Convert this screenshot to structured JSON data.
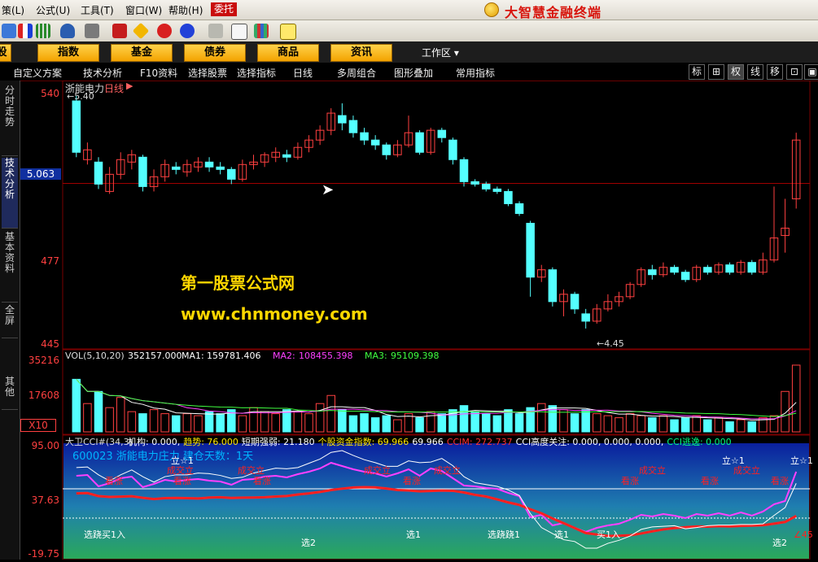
{
  "menubar": {
    "items": [
      {
        "label": "策(L)"
      },
      {
        "label": "公式(U)"
      },
      {
        "label": "工具(T)"
      },
      {
        "label": "窗口(W)"
      },
      {
        "label": "帮助(H)"
      }
    ],
    "order_button": "委托",
    "brand": "大智慧金融终端"
  },
  "category_bar": {
    "items": [
      "股",
      "指数",
      "基金",
      "债券",
      "商品",
      "资讯"
    ],
    "workspace_label": "工作区"
  },
  "sub_toolbar": {
    "items": [
      "自定义方案",
      "技术分析",
      "F10资料",
      "选择股票",
      "选择指标",
      "日线",
      "多周组合",
      "图形叠加",
      "常用指标"
    ],
    "right_buttons": [
      "标",
      "⊞",
      "权",
      "线",
      "移",
      "⊡",
      "▣"
    ]
  },
  "left_tabs": [
    "分时走势",
    "技术分析",
    "基本资料",
    "全屏",
    "其他"
  ],
  "price_chart": {
    "stock_name": "浙能电力",
    "period": "日线",
    "high_note": "5.40",
    "low_note": "4.45",
    "y_ticks": [
      "540",
      "5.063",
      "477",
      "445"
    ],
    "ylim": [
      4.4,
      5.45
    ],
    "current_price": 5.063,
    "candles": [
      [
        5.4,
        5.19,
        5.17,
        5.42
      ],
      [
        5.16,
        5.2,
        5.14,
        5.23
      ],
      [
        5.15,
        5.06,
        5.04,
        5.17
      ],
      [
        5.03,
        5.1,
        5.02,
        5.13
      ],
      [
        5.1,
        5.16,
        5.08,
        5.19
      ],
      [
        5.15,
        5.18,
        5.12,
        5.2
      ],
      [
        5.17,
        5.05,
        5.03,
        5.18
      ],
      [
        5.05,
        5.09,
        5.03,
        5.12
      ],
      [
        5.09,
        5.14,
        5.07,
        5.16
      ],
      [
        5.13,
        5.12,
        5.1,
        5.15
      ],
      [
        5.11,
        5.14,
        5.09,
        5.16
      ],
      [
        5.13,
        5.15,
        5.11,
        5.17
      ],
      [
        5.15,
        5.13,
        5.11,
        5.17
      ],
      [
        5.13,
        5.12,
        5.1,
        5.15
      ],
      [
        5.12,
        5.08,
        5.06,
        5.13
      ],
      [
        5.08,
        5.14,
        5.07,
        5.16
      ],
      [
        5.14,
        5.15,
        5.12,
        5.18
      ],
      [
        5.15,
        5.18,
        5.13,
        5.19
      ],
      [
        5.17,
        5.19,
        5.15,
        5.21
      ],
      [
        5.18,
        5.17,
        5.15,
        5.2
      ],
      [
        5.17,
        5.21,
        5.16,
        5.23
      ],
      [
        5.21,
        5.24,
        5.19,
        5.26
      ],
      [
        5.24,
        5.28,
        5.22,
        5.3
      ],
      [
        5.28,
        5.35,
        5.26,
        5.37
      ],
      [
        5.34,
        5.31,
        5.28,
        5.39
      ],
      [
        5.32,
        5.27,
        5.25,
        5.34
      ],
      [
        5.27,
        5.24,
        5.22,
        5.29
      ],
      [
        5.24,
        5.22,
        5.2,
        5.26
      ],
      [
        5.22,
        5.18,
        5.16,
        5.23
      ],
      [
        5.18,
        5.22,
        5.17,
        5.24
      ],
      [
        5.22,
        5.27,
        5.21,
        5.34
      ],
      [
        5.27,
        5.19,
        5.18,
        5.28
      ],
      [
        5.19,
        5.28,
        5.18,
        5.29
      ],
      [
        5.28,
        5.25,
        5.23,
        5.29
      ],
      [
        5.24,
        5.16,
        5.14,
        5.25
      ],
      [
        5.16,
        5.07,
        5.05,
        5.17
      ],
      [
        5.07,
        5.06,
        5.05,
        5.08
      ],
      [
        5.06,
        5.04,
        5.03,
        5.07
      ],
      [
        5.04,
        5.03,
        5.02,
        5.05
      ],
      [
        5.03,
        4.98,
        4.97,
        5.04
      ],
      [
        4.98,
        4.94,
        4.93,
        4.99
      ],
      [
        4.9,
        4.68,
        4.6,
        4.91
      ],
      [
        4.68,
        4.71,
        4.66,
        4.73
      ],
      [
        4.71,
        4.58,
        4.56,
        4.72
      ],
      [
        4.58,
        4.61,
        4.52,
        4.63
      ],
      [
        4.61,
        4.55,
        4.53,
        4.62
      ],
      [
        4.53,
        4.5,
        4.47,
        4.55
      ],
      [
        4.5,
        4.55,
        4.49,
        4.57
      ],
      [
        4.55,
        4.58,
        4.54,
        4.61
      ],
      [
        4.58,
        4.6,
        4.56,
        4.62
      ],
      [
        4.6,
        4.65,
        4.59,
        4.66
      ],
      [
        4.65,
        4.71,
        4.64,
        4.72
      ],
      [
        4.71,
        4.69,
        4.67,
        4.73
      ],
      [
        4.69,
        4.72,
        4.68,
        4.74
      ],
      [
        4.72,
        4.7,
        4.69,
        4.73
      ],
      [
        4.7,
        4.67,
        4.66,
        4.71
      ],
      [
        4.67,
        4.72,
        4.66,
        4.73
      ],
      [
        4.72,
        4.7,
        4.69,
        4.73
      ],
      [
        4.7,
        4.73,
        4.69,
        4.74
      ],
      [
        4.73,
        4.7,
        4.69,
        4.74
      ],
      [
        4.7,
        4.74,
        4.69,
        4.75
      ],
      [
        4.74,
        4.7,
        4.69,
        4.75
      ],
      [
        4.7,
        4.75,
        4.69,
        4.78
      ],
      [
        4.75,
        4.84,
        4.74,
        5.05
      ],
      [
        4.85,
        4.88,
        4.78,
        5.0
      ],
      [
        5.0,
        5.24,
        4.96,
        5.27
      ]
    ]
  },
  "volume_chart": {
    "header": "VOL(5,10,20)",
    "vol_value": "352157.000",
    "ma1_label": "MA1:",
    "ma1_value": "159781.406",
    "ma2_label": "MA2:",
    "ma2_value": "108455.398",
    "ma3_label": "MA3:",
    "ma3_value": "95109.398",
    "y_ticks": [
      "35216",
      "17608"
    ],
    "unit": "X10",
    "ylim": [
      0,
      37000
    ],
    "values": [
      26000,
      14000,
      20000,
      12000,
      17000,
      10000,
      9000,
      11000,
      9000,
      8000,
      9000,
      8000,
      10000,
      9000,
      11000,
      8000,
      12000,
      10000,
      9000,
      11000,
      10000,
      9000,
      14000,
      18000,
      11000,
      8000,
      9000,
      7000,
      8000,
      6000,
      9000,
      7000,
      10000,
      9000,
      11000,
      13000,
      10000,
      9000,
      8000,
      11000,
      9000,
      12000,
      14000,
      13000,
      11000,
      9000,
      11000,
      9000,
      8000,
      7000,
      9000,
      8000,
      7000,
      8000,
      6000,
      7000,
      8000,
      6000,
      7000,
      5000,
      6000,
      5000,
      7000,
      8000,
      20000,
      33000
    ]
  },
  "cci_chart": {
    "title": "大卫CCI#(34,3)",
    "header_items": [
      {
        "label": "机构:",
        "value": "0.000,",
        "color": "#ffffff"
      },
      {
        "label": "趋势:",
        "value": "76.000",
        "color": "#ffe600"
      },
      {
        "label": "短期强弱:",
        "value": "21.180",
        "color": "#ffffff"
      },
      {
        "label": "个股资金指数:",
        "value": "69.966",
        "color": "#ffe600"
      },
      {
        "label": "",
        "value": "69.966",
        "color": "#ffffff"
      },
      {
        "label": "CCIM:",
        "value": "272.737",
        "color": "#ff3030"
      },
      {
        "label": "CCI高度关注:",
        "value": "0.000, 0.000, 0.000,",
        "color": "#ffffff"
      },
      {
        "label": "CCI逃逸:",
        "value": "0.000",
        "color": "#00ff80"
      }
    ],
    "info_line": "600023 浙能电力庄力 建仓天数：1天",
    "y_ticks": [
      "95.00",
      "37.63",
      "-19.75"
    ],
    "labels_up": [
      "看涨",
      "看涨",
      "看涨",
      "看涨",
      "看涨",
      "看涨",
      "看涨",
      "看涨"
    ],
    "labels_stand": [
      "成交立",
      "成交立",
      "成交立",
      "成交立",
      "成交立",
      "成交立"
    ],
    "labels_li": [
      "立☆1",
      "立☆1",
      "立☆1"
    ],
    "labels_bottom": [
      "选跷买1入",
      "选2",
      "选1",
      "选跷跷1",
      "选1",
      "买1入",
      "选2"
    ],
    "last_mark": "∠45"
  },
  "watermark": {
    "line1": "第一股票公式网",
    "line2": "www.chnmoney.com"
  },
  "colors": {
    "up": "#ff4040",
    "down": "#54ffff",
    "accent": "#ffd700",
    "ma2": "#ff40ff",
    "ma3": "#40ff40"
  }
}
